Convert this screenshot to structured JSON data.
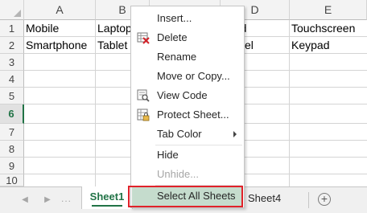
{
  "columns": [
    "A",
    "B",
    "C",
    "D",
    "E"
  ],
  "rows": [
    "1",
    "2",
    "3",
    "4",
    "5",
    "6",
    "7",
    "8",
    "9",
    "10"
  ],
  "active_row": "6",
  "cells": {
    "a1": "Mobile",
    "b1": "Laptop",
    "d1": "rd",
    "e1": "Touchscreen",
    "a2": "Smartphone",
    "b2": "Tablet",
    "d2": "el",
    "e2": "Keypad"
  },
  "sheet_tabs": {
    "active": "Sheet1",
    "partial": "Sheet4",
    "nav_dots": "...",
    "add_label": "+"
  },
  "context_menu": {
    "items": [
      {
        "label": "Insert...",
        "icon": null,
        "enabled": true
      },
      {
        "label": "Delete",
        "icon": "delete-sheet-icon",
        "enabled": true
      },
      {
        "label": "Rename",
        "icon": null,
        "enabled": true
      },
      {
        "label": "Move or Copy...",
        "icon": null,
        "enabled": true
      },
      {
        "label": "View Code",
        "icon": "view-code-icon",
        "enabled": true
      },
      {
        "label": "Protect Sheet...",
        "icon": "protect-sheet-icon",
        "enabled": true
      },
      {
        "label": "Tab Color",
        "icon": null,
        "enabled": true,
        "submenu": true
      },
      {
        "label": "Hide",
        "icon": null,
        "enabled": true
      },
      {
        "label": "Unhide...",
        "icon": null,
        "enabled": false
      },
      {
        "label": "Select All Sheets",
        "icon": null,
        "enabled": true,
        "highlighted": true
      }
    ]
  },
  "colors": {
    "accent_green": "#217346",
    "highlight": "#c5dccd",
    "annotation_red": "#e0222a"
  }
}
